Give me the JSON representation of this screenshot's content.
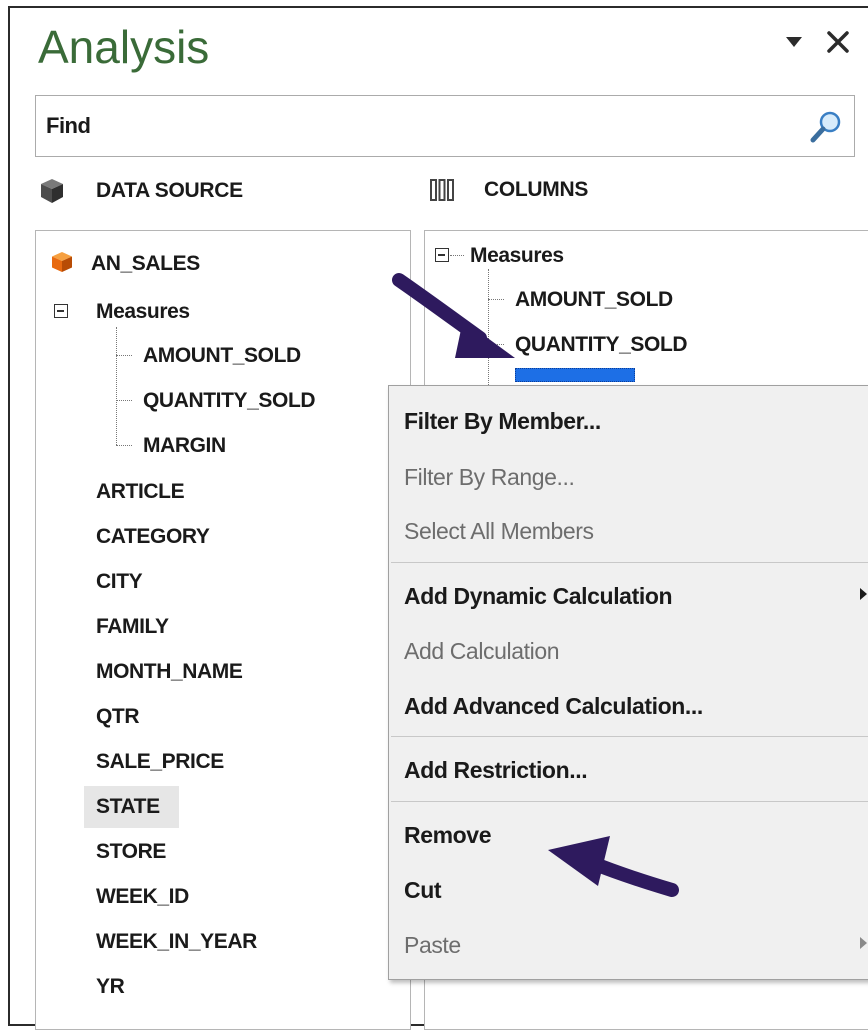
{
  "pane": {
    "title": "Analysis"
  },
  "search": {
    "placeholder": "Find"
  },
  "sections": {
    "data_source_label": "DATA SOURCE",
    "columns_label": "COLUMNS"
  },
  "data_source": {
    "cube_name": "AN_SALES",
    "measures_label": "Measures",
    "measures": [
      "AMOUNT_SOLD",
      "QUANTITY_SOLD",
      "MARGIN"
    ],
    "dimensions": [
      "ARTICLE",
      "CATEGORY",
      "CITY",
      "FAMILY",
      "MONTH_NAME",
      "QTR",
      "SALE_PRICE",
      "STATE",
      "STORE",
      "WEEK_ID",
      "WEEK_IN_YEAR",
      "YR"
    ],
    "selected_dimension": "STATE"
  },
  "columns": {
    "measures_label": "Measures",
    "items": [
      "AMOUNT_SOLD",
      "QUANTITY_SOLD"
    ]
  },
  "context_menu": {
    "items": [
      {
        "label": "Filter By Member...",
        "enabled": true
      },
      {
        "label": "Filter By Range...",
        "enabled": false
      },
      {
        "label": "Select All Members",
        "enabled": false
      },
      {
        "label": "Add Dynamic Calculation",
        "enabled": true,
        "submenu": true
      },
      {
        "label": "Add Calculation",
        "enabled": false
      },
      {
        "label": "Add Advanced Calculation...",
        "enabled": true
      },
      {
        "label": "Add Restriction...",
        "enabled": true
      },
      {
        "label": "Remove",
        "enabled": true
      },
      {
        "label": "Cut",
        "enabled": true
      },
      {
        "label": "Paste",
        "enabled": false,
        "submenu": true
      }
    ]
  },
  "colors": {
    "title": "#3a6b38",
    "cube_icon": "#e86a10",
    "drop_target": "#1d6fe6",
    "annotation_arrow": "#2e1a5e"
  }
}
